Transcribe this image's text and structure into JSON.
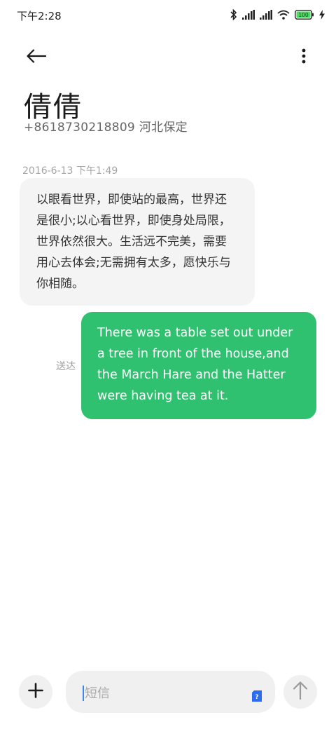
{
  "status_bar": {
    "time": "下午2:28",
    "icons": [
      "bluetooth-icon",
      "signal-icon",
      "signal-icon",
      "wifi-icon",
      "battery-icon",
      "charging-icon"
    ],
    "battery_label": "100",
    "battery_color": "#4cd964"
  },
  "header": {
    "back_icon": "arrow-left-icon",
    "menu_icon": "more-vertical-icon"
  },
  "contact": {
    "name": "倩倩",
    "phone_and_location": "+8618730218809 河北保定"
  },
  "conversation": {
    "timestamp": "2016-6-13 下午1:49",
    "messages": [
      {
        "direction": "incoming",
        "text": "以眼看世界，即使站的最高，世界还是很小;以心看世界，即使身处局限，世界依然很大。生活远不完美，需要用心去体会;无需拥有太多，愿快乐与你相随。"
      },
      {
        "direction": "outgoing",
        "text": "There was a table set out under a tree in front of the house,and the March Hare and the Hatter were having tea at it.",
        "status": "送达"
      }
    ],
    "outgoing_color": "#30c170"
  },
  "composer": {
    "add_icon": "plus-icon",
    "placeholder": "短信",
    "sim_icon": "sim-card-icon",
    "sim_label": "?",
    "send_icon": "arrow-up-icon",
    "accent": "#3a86f5"
  }
}
